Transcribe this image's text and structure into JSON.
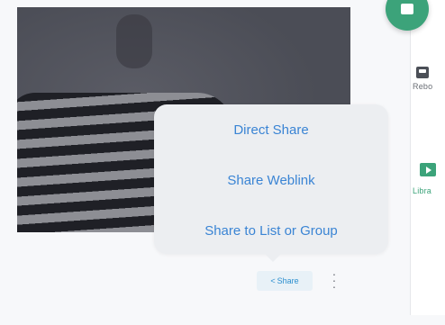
{
  "share_menu": {
    "items": [
      {
        "label": "Direct Share"
      },
      {
        "label": "Share Weblink"
      },
      {
        "label": "Share to List or Group"
      }
    ]
  },
  "toolbar": {
    "share_label": "Share"
  },
  "sidebar": {
    "items": [
      {
        "label": "Rebo",
        "icon": "recordings-icon"
      },
      {
        "label": "Libra",
        "icon": "library-icon"
      }
    ]
  },
  "icons": {
    "fab": "new-content-icon",
    "share": "share-icon",
    "more": "more-vertical-icon"
  },
  "colors": {
    "accent_green": "#3ca37a",
    "link_blue": "#3a84d4",
    "popover_bg": "#eceef1"
  }
}
